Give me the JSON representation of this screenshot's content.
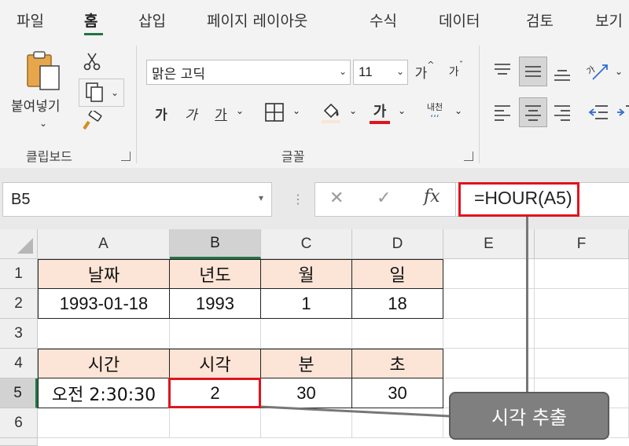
{
  "ribbon_tabs": [
    "파일",
    "홈",
    "삽입",
    "페이지 레이아웃",
    "수식",
    "데이터",
    "검토",
    "보기"
  ],
  "active_tab": "홈",
  "clipboard": {
    "paste_label": "붙여넣기",
    "group_label": "클립보드",
    "icons": [
      "paste-icon",
      "cut-icon",
      "copy-icon",
      "format-painter-icon"
    ]
  },
  "font": {
    "name": "맑은 고딕",
    "size": "11",
    "grow_label": "가",
    "shrink_label": "가",
    "bold_label": "가",
    "italic_label": "가",
    "underline_label": "가",
    "font_color_label": "가",
    "phonetic_label": "내천",
    "group_label": "글꼴",
    "font_color": "#e0141e"
  },
  "name_box": "B5",
  "fx_label": "fx",
  "formula": "=HOUR(A5)",
  "columns": [
    "A",
    "B",
    "C",
    "D",
    "E",
    "F"
  ],
  "active_column": "B",
  "rows": [
    "1",
    "2",
    "3",
    "4",
    "5",
    "6"
  ],
  "active_row": "5",
  "cells": {
    "A1": "날짜",
    "B1": "년도",
    "C1": "월",
    "D1": "일",
    "A2": "1993-01-18",
    "B2": "1993",
    "C2": "1",
    "D2": "18",
    "A4": "시간",
    "B4": "시각",
    "C4": "분",
    "D4": "초",
    "A5": "오전 2:30:30",
    "B5": "2",
    "C5": "30",
    "D5": "30"
  },
  "callout_text": "시각 추출",
  "colors": {
    "accent_green": "#217346",
    "header_fill": "#fce4d6",
    "highlight_red": "#e0141e",
    "callout_gray": "#7f7f7f"
  }
}
